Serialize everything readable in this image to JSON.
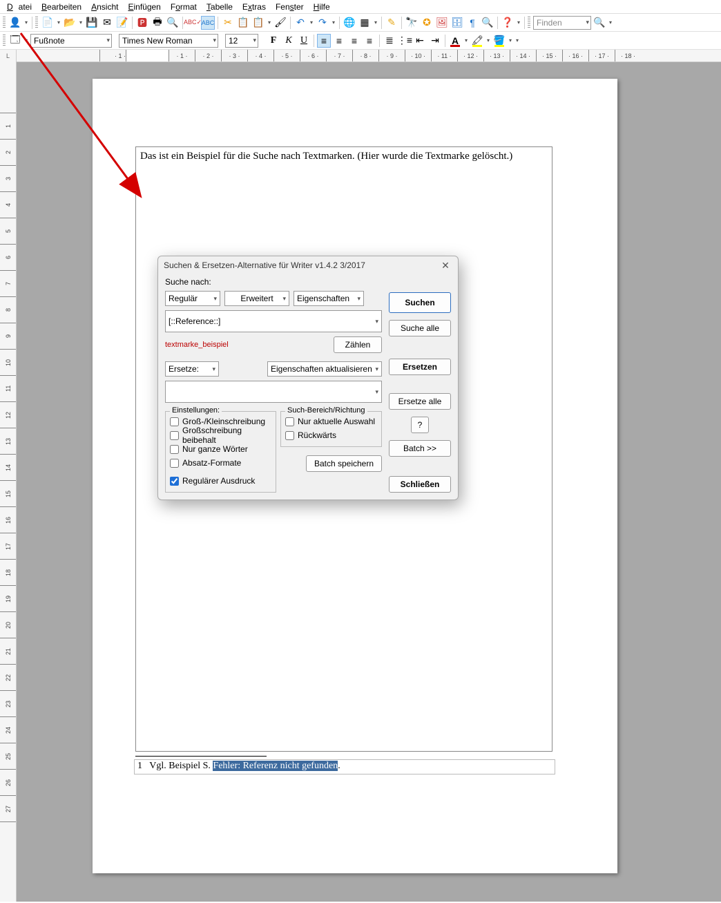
{
  "menu": {
    "file": "Datei",
    "edit": "Bearbeiten",
    "view": "Ansicht",
    "insert": "Einfügen",
    "format": "Format",
    "table": "Tabelle",
    "extras": "Extras",
    "window": "Fenster",
    "help": "Hilfe"
  },
  "toolbar2": {
    "style": "Fußnote",
    "font": "Times New Roman",
    "size": "12"
  },
  "findbox": {
    "placeholder": "Finden"
  },
  "document": {
    "main_text": "Das ist ein Beispiel für die Suche nach Textmarken.",
    "deleted_note": " (Hier wurde die Textmarke gelöscht.)",
    "footnote_num": "1",
    "footnote_prefix": "Vgl. Beispiel S. ",
    "footnote_error": "Fehler: Referenz nicht gefunden",
    "footnote_suffix": "."
  },
  "dialog": {
    "title": "Suchen & Ersetzen-Alternative für Writer  v1.4.2  3/2017",
    "search_label": "Suche nach:",
    "regular": "Regulär",
    "extended": "Erweitert",
    "properties": "Eigenschaften",
    "search_value": "[::Reference::]",
    "status": "textmarke_beispiel",
    "count": "Zählen",
    "replace_label": "Ersetze:",
    "update_props": "Eigenschaften aktualisieren",
    "replace_value": "",
    "settings_legend": "Einstellungen:",
    "chk_case": "Groß-/Kleinschreibung",
    "chk_keepcase": "Großschreibung beibehalt",
    "chk_whole": "Nur ganze Wörter",
    "chk_para": "Absatz-Formate",
    "chk_regex": "Regulärer Ausdruck",
    "scope_legend": "Such-Bereich/Richtung",
    "chk_selection": "Nur aktuelle Auswahl",
    "chk_backwards": "Rückwärts",
    "batch_save": "Batch speichern",
    "btn_search": "Suchen",
    "btn_search_all": "Suche alle",
    "btn_replace": "Ersetzen",
    "btn_replace_all": "Ersetze alle",
    "btn_help": "?",
    "btn_batch": "Batch >>",
    "btn_close": "Schließen"
  },
  "ruler_marks": [
    "1",
    "",
    "1",
    "2",
    "3",
    "4",
    "5",
    "6",
    "7",
    "8",
    "9",
    "10",
    "11",
    "12",
    "13",
    "14",
    "15",
    "16",
    "17",
    "18"
  ]
}
